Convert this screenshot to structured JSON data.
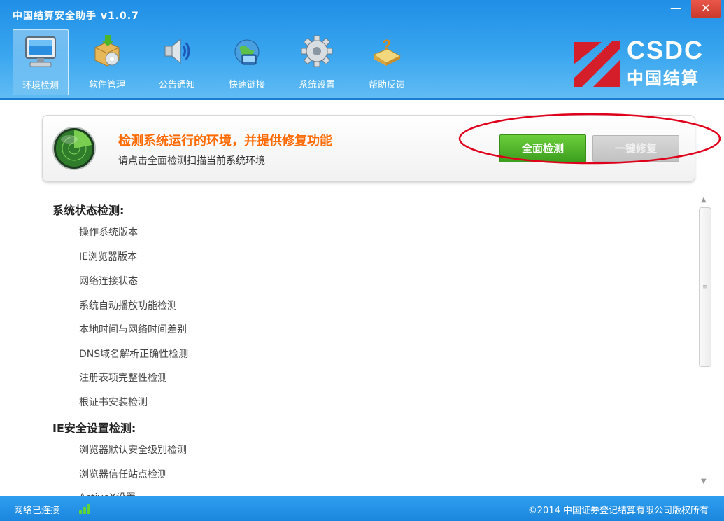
{
  "window": {
    "title": "中国结算安全助手 v1.0.7",
    "minimize": "—",
    "close": "✕"
  },
  "toolbar": {
    "active_tab": "环境检测",
    "items": [
      {
        "label": "环境检测",
        "icon": "monitor-icon"
      },
      {
        "label": "软件管理",
        "icon": "software-box-icon"
      },
      {
        "label": "公告通知",
        "icon": "speaker-icon"
      },
      {
        "label": "快速链接",
        "icon": "globe-link-icon"
      },
      {
        "label": "系统设置",
        "icon": "gear-icon"
      },
      {
        "label": "帮助反馈",
        "icon": "help-book-icon"
      }
    ]
  },
  "logo": {
    "text": "CSDC",
    "cn": "中国结算"
  },
  "panel": {
    "title": "检测系统运行的环境，并提供修复功能",
    "subtitle": "请点击全面检测扫描当前系统环境",
    "scan_button": "全面检测",
    "fix_button": "一键修复"
  },
  "sections": [
    {
      "title": "系统状态检测:",
      "items": [
        "操作系统版本",
        "IE浏览器版本",
        "网络连接状态",
        "系统自动播放功能检测",
        "本地时间与网络时间差别",
        "DNS域名解析正确性检测",
        "注册表项完整性检测",
        "根证书安装检测"
      ]
    },
    {
      "title": "IE安全设置检测:",
      "items": [
        "浏览器默认安全级别检测",
        "浏览器信任站点检测",
        "ActiveX设置"
      ]
    }
  ],
  "statusbar": {
    "network": "网络已连接",
    "copyright": "©2014 中国证券登记结算有限公司版权所有"
  },
  "colors": {
    "header": "#2a9be9",
    "accent_orange": "#ff6a00",
    "green_button": "#4cb52a",
    "highlight_ring": "#e0001b"
  }
}
